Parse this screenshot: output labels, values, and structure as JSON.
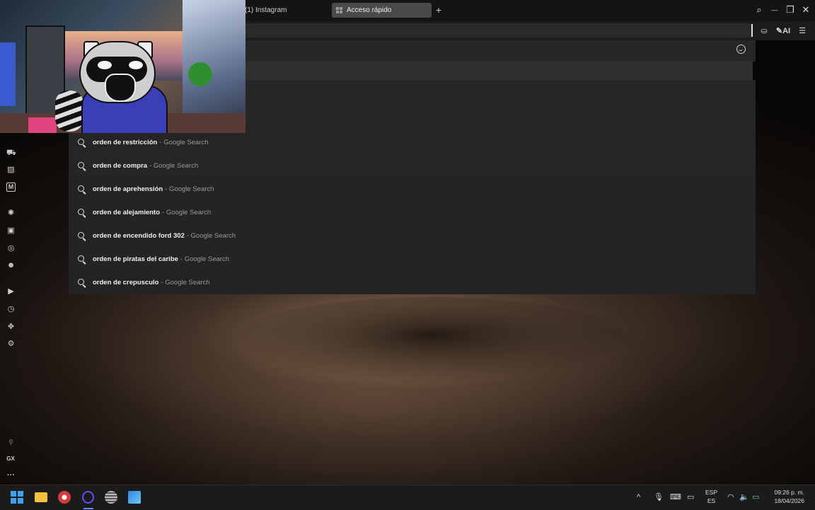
{
  "tabs": {
    "instagram": "(1) Instagram",
    "active": "Acceso rápido",
    "new_tab": "+"
  },
  "window_controls": {
    "search": "⌕",
    "minimize": "—",
    "maximize": "❐",
    "close": "✕"
  },
  "address_bar": {
    "value": "",
    "ai_label": "AI"
  },
  "suggestions": [
    {
      "query": "orden de restricción",
      "suffix": "- Google Search"
    },
    {
      "query": "orden de compra",
      "suffix": "- Google Search"
    },
    {
      "query": "orden de aprehensión",
      "suffix": "- Google Search"
    },
    {
      "query": "orden de alejamiento",
      "suffix": "- Google Search"
    },
    {
      "query": "orden de encendido ford 302",
      "suffix": "- Google Search"
    },
    {
      "query": "orden de piratas del caribe",
      "suffix": "- Google Search"
    },
    {
      "query": "orden de crepusculo",
      "suffix": "- Google Search"
    }
  ],
  "sidebar": {
    "gx_label": "GX",
    "more_label": "···"
  },
  "taskbar": {
    "lang_top": "ESP",
    "lang_bottom": "ES",
    "time": "09:26 p. m.",
    "date": "18/04/2026"
  },
  "colors": {
    "accent": "#3ea0f0",
    "tab_active_bg": "#4a4a4a",
    "panel_bg": "#262626"
  }
}
